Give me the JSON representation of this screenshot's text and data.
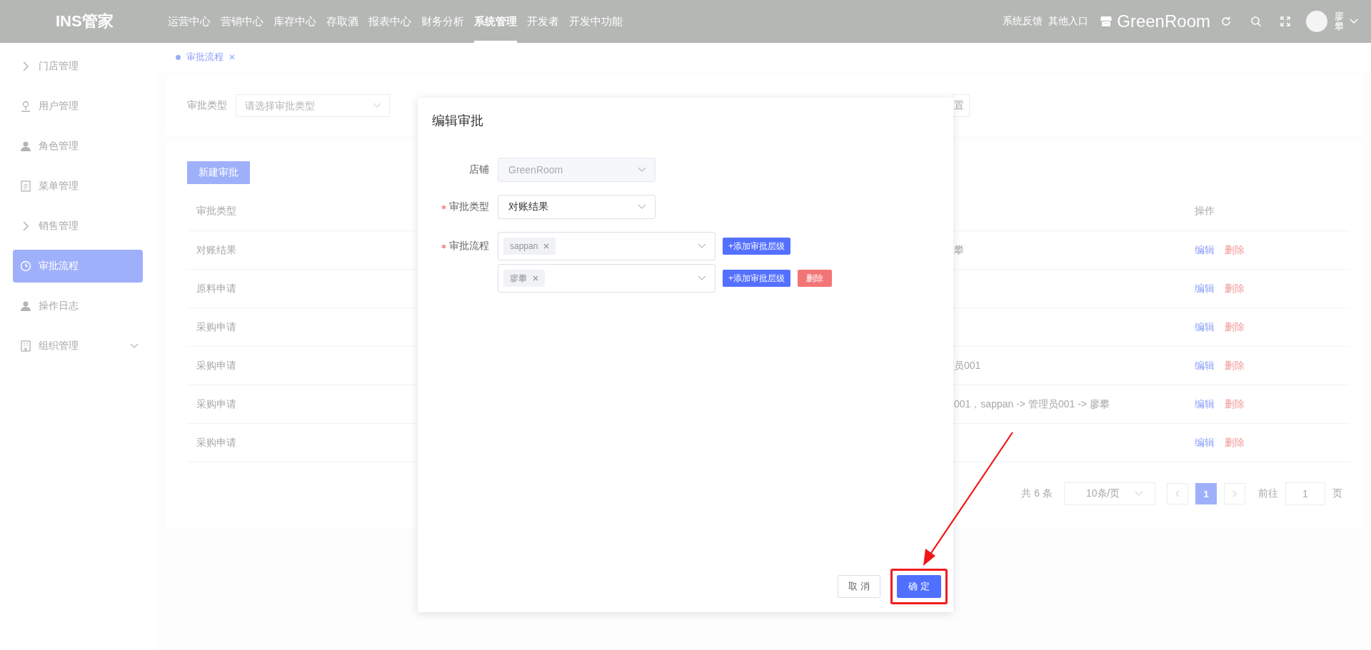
{
  "top_bar": {
    "logo": "INS管家",
    "nav": [
      {
        "label": "运营中心",
        "selected": false
      },
      {
        "label": "营销中心",
        "selected": false
      },
      {
        "label": "库存中心",
        "selected": false
      },
      {
        "label": "存取酒",
        "selected": false
      },
      {
        "label": "报表中心",
        "selected": false
      },
      {
        "label": "财务分析",
        "selected": false
      },
      {
        "label": "系统管理",
        "selected": true
      },
      {
        "label": "开发者",
        "selected": false
      },
      {
        "label": "开发中功能",
        "selected": false
      }
    ],
    "links": [
      "系统反馈",
      "其他入口"
    ],
    "store_name": "GreenRoom",
    "user_name": "廖攀"
  },
  "sidebar": {
    "items": [
      {
        "label": "门店管理",
        "kind": "chevron",
        "selected": false,
        "expandable": false
      },
      {
        "label": "用户管理",
        "kind": "user-outline",
        "selected": false,
        "expandable": false
      },
      {
        "label": "角色管理",
        "kind": "user",
        "selected": false,
        "expandable": false
      },
      {
        "label": "菜单管理",
        "kind": "document",
        "selected": false,
        "expandable": false
      },
      {
        "label": "销售管理",
        "kind": "chevron",
        "selected": false,
        "expandable": false
      },
      {
        "label": "审批流程",
        "kind": "clock",
        "selected": true,
        "expandable": false
      },
      {
        "label": "操作日志",
        "kind": "user",
        "selected": false,
        "expandable": false
      },
      {
        "label": "组织管理",
        "kind": "building",
        "selected": false,
        "expandable": true
      }
    ]
  },
  "tabs": [
    {
      "label": "审批流程",
      "selected": true
    }
  ],
  "filter": {
    "label": "审批类型",
    "placeholder": "请选择审批类型",
    "button": "置"
  },
  "table": {
    "new_button": "新建审批",
    "columns": [
      "审批类型",
      "操作"
    ],
    "rows": [
      {
        "type": "对账结果",
        "process": "攀",
        "actions": [
          "编辑",
          "删除"
        ]
      },
      {
        "type": "原料申请",
        "actions": [
          "编辑",
          "删除"
        ]
      },
      {
        "type": "采购申请",
        "actions": [
          "编辑",
          "删除"
        ]
      },
      {
        "type": "采购申请",
        "process": "员001",
        "actions": [
          "编辑",
          "删除"
        ]
      },
      {
        "type": "采购申请",
        "process": "001，sappan -> 管理员001 -> 廖攀",
        "actions": [
          "编辑",
          "删除"
        ]
      },
      {
        "type": "采购申请",
        "actions": [
          "编辑",
          "删除"
        ]
      }
    ]
  },
  "pagination": {
    "total": "共 6 条",
    "page_size": "10条/页",
    "pages": [
      {
        "label": "1",
        "selected": true
      }
    ],
    "goto_label": "前往",
    "goto_value": "1",
    "page_suffix": "页"
  },
  "dialog": {
    "title": "编辑审批",
    "fields": [
      {
        "kind": "select",
        "label": "店铺",
        "required": false,
        "value": "GreenRoom",
        "disabled": true
      },
      {
        "kind": "select",
        "label": "审批类型",
        "required": true,
        "value": "对账结果",
        "disabled": false
      },
      {
        "kind": "levels",
        "label": "审批流程",
        "required": true,
        "levels": [
          {
            "tags": [
              "sappan"
            ],
            "add_button": "+添加审批层级"
          },
          {
            "tags": [
              "廖攀"
            ],
            "add_button": "+添加审批层级",
            "delete_button": "删除"
          }
        ]
      }
    ],
    "buttons": [
      {
        "label": "取 消",
        "kind": "default",
        "highlighted": false
      },
      {
        "label": "确 定",
        "kind": "primary",
        "highlighted": true
      }
    ]
  }
}
